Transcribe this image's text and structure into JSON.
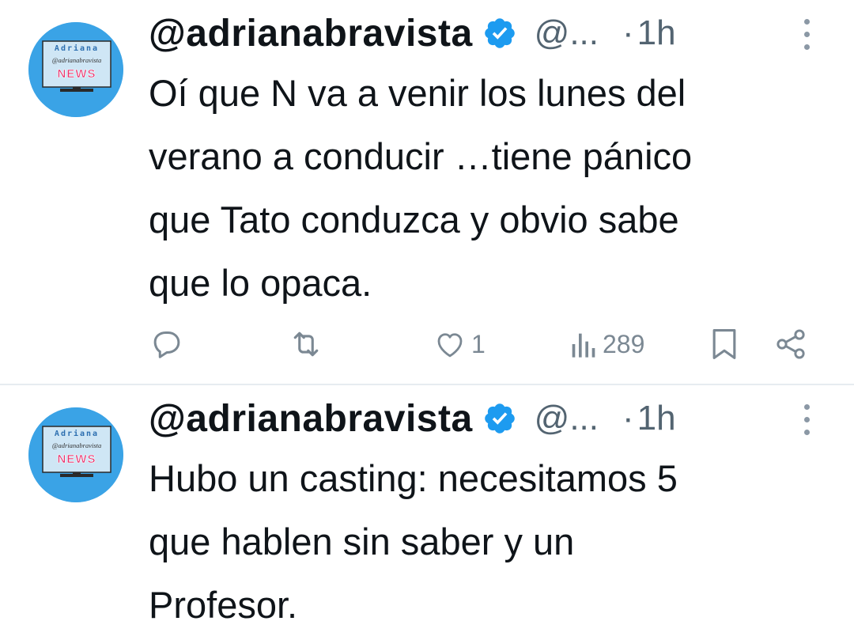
{
  "colors": {
    "text": "#0f1419",
    "muted": "#536471",
    "icon": "#7b8893",
    "verified": "#1d9bf0",
    "avatar_bg": "#3aa3e6"
  },
  "tweets": [
    {
      "username": "@adrianabravista",
      "handle": "@...",
      "dot": "·",
      "time": "1h",
      "avatar_text": {
        "top": "Adriana",
        "middle": "@adrianabravista",
        "bottom": "NEWS"
      },
      "text": "Oí que N va a venir los lunes del\nverano a conducir …tiene pánico\nque Tato conduzca y obvio sabe\nque lo opaca.",
      "actions": {
        "reply_icon": "reply-icon",
        "retweet_icon": "retweet-icon",
        "like_icon": "heart-icon",
        "likes": "1",
        "views_icon": "views-icon",
        "views": "289",
        "bookmark_icon": "bookmark-icon",
        "share_icon": "share-icon"
      }
    },
    {
      "username": "@adrianabravista",
      "handle": "@...",
      "dot": "·",
      "time": "1h",
      "avatar_text": {
        "top": "Adriana",
        "middle": "@adrianabravista",
        "bottom": "NEWS"
      },
      "text": "Hubo un casting: necesitamos 5\nque hablen sin saber y un\nProfesor."
    }
  ]
}
